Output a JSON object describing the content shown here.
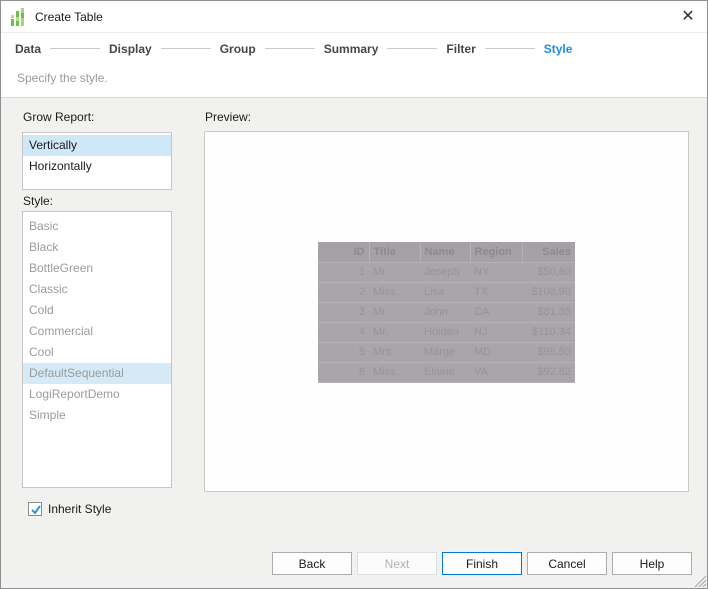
{
  "window": {
    "title": "Create Table",
    "close_glyph": "✕"
  },
  "steps": {
    "labels": [
      "Data",
      "Display",
      "Group",
      "Summary",
      "Filter",
      "Style"
    ],
    "active": "Style",
    "active_color": "#1d8ed8"
  },
  "subtitle": "Specify the style.",
  "grow_report": {
    "label": "Grow Report:",
    "options": [
      "Vertically",
      "Horizontally"
    ],
    "selected": "Vertically"
  },
  "style_list": {
    "label": "Style:",
    "options": [
      "Basic",
      "Black",
      "BottleGreen",
      "Classic",
      "Cold",
      "Commercial",
      "Cool",
      "DefaultSequential",
      "LogiReportDemo",
      "Simple"
    ],
    "selected": "DefaultSequential",
    "disabled": true
  },
  "inherit_style": {
    "label": "Inherit Style",
    "checked": true
  },
  "preview": {
    "label": "Preview:",
    "table": {
      "columns": [
        "ID",
        "Title",
        "Name",
        "Region",
        "Sales"
      ],
      "rows": [
        [
          "1",
          "Mr.",
          "Joseph",
          "NY",
          "$50,60"
        ],
        [
          "2",
          "Miss.",
          "Lisa",
          "TX",
          "$108,90"
        ],
        [
          "3",
          "Mr.",
          "John",
          "CA",
          "$81,35"
        ],
        [
          "4",
          "Mr.",
          "Holden",
          "NJ",
          "$110,34"
        ],
        [
          "5",
          "Mrs.",
          "Marge",
          "MD",
          "$95.50"
        ],
        [
          "6",
          "Miss.",
          "Elaine",
          "VA",
          "$92.82"
        ]
      ]
    }
  },
  "buttons": {
    "back": "Back",
    "next": "Next",
    "finish": "Finish",
    "cancel": "Cancel",
    "help": "Help"
  }
}
